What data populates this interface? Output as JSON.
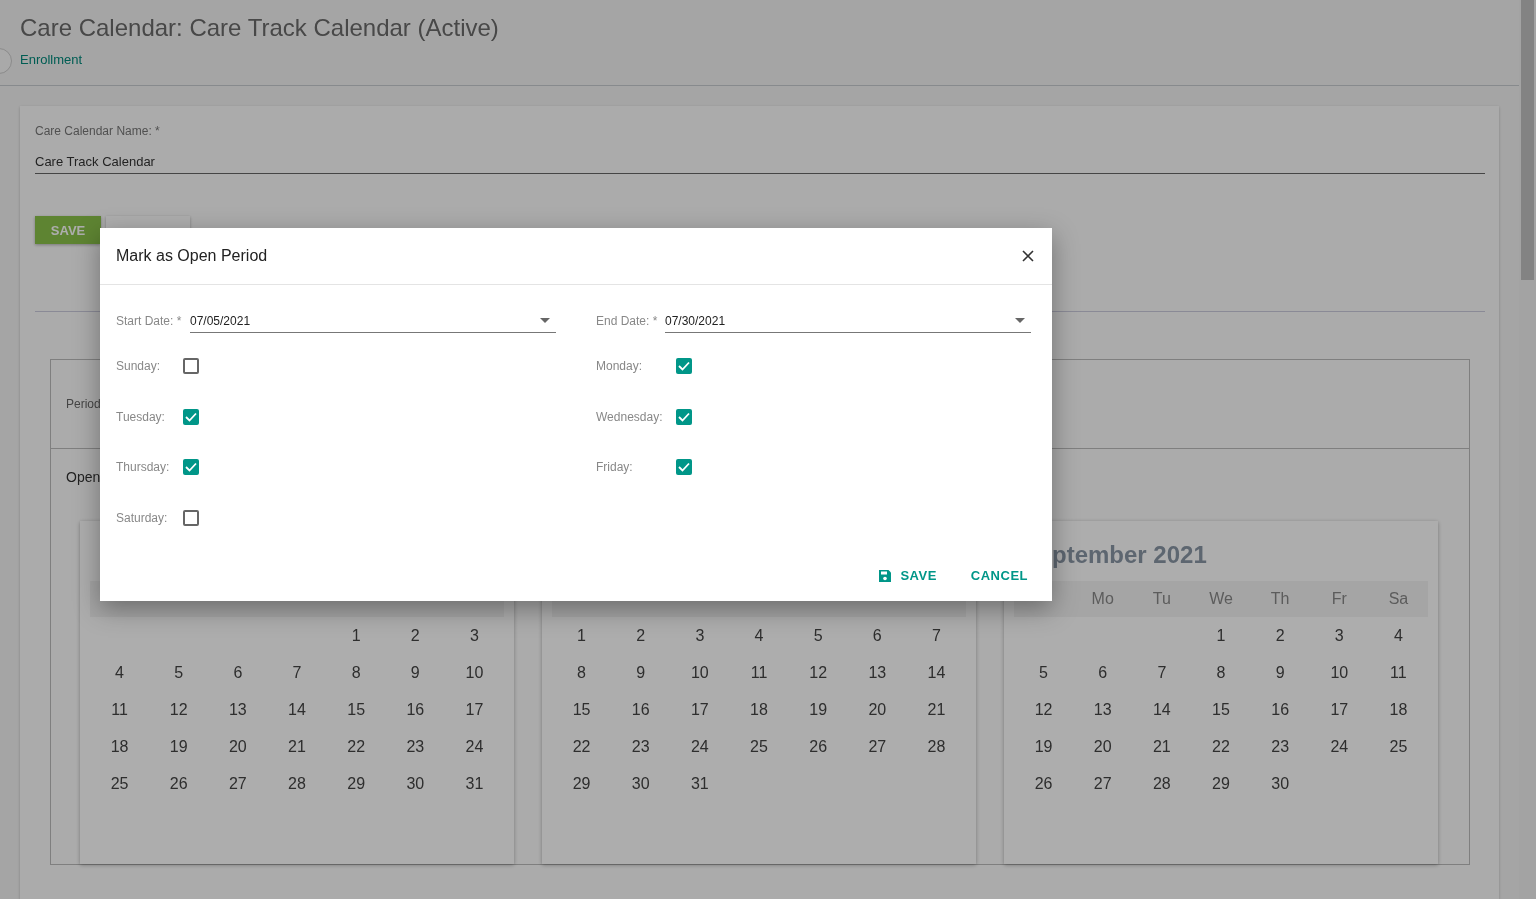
{
  "header": {
    "title": "Care Calendar: Care Track Calendar (Active)",
    "breadcrumb": "Enrollment"
  },
  "form": {
    "name_label": "Care Calendar Name: *",
    "name_value": "Care Track Calendar",
    "save_button": "SAVE"
  },
  "period_panel": {
    "period_label": "Period",
    "open_label": "Open"
  },
  "calendars": [
    {
      "weeks": [
        {
          "kind": "leading",
          "days": [
            "1",
            "2",
            "3"
          ]
        },
        {
          "kind": "full",
          "days": [
            "4",
            "5",
            "6",
            "7",
            "8",
            "9",
            "10"
          ]
        },
        {
          "kind": "full",
          "days": [
            "11",
            "12",
            "13",
            "14",
            "15",
            "16",
            "17"
          ]
        },
        {
          "kind": "full",
          "days": [
            "18",
            "19",
            "20",
            "21",
            "22",
            "23",
            "24"
          ]
        },
        {
          "kind": "full",
          "days": [
            "25",
            "26",
            "27",
            "28",
            "29",
            "30",
            "31"
          ]
        }
      ]
    },
    {
      "weeks": [
        {
          "kind": "full",
          "days": [
            "1",
            "2",
            "3",
            "4",
            "5",
            "6",
            "7"
          ]
        },
        {
          "kind": "full",
          "days": [
            "8",
            "9",
            "10",
            "11",
            "12",
            "13",
            "14"
          ]
        },
        {
          "kind": "full",
          "days": [
            "15",
            "16",
            "17",
            "18",
            "19",
            "20",
            "21"
          ]
        },
        {
          "kind": "full",
          "days": [
            "22",
            "23",
            "24",
            "25",
            "26",
            "27",
            "28"
          ]
        },
        {
          "kind": "trailing",
          "days": [
            "29",
            "30",
            "31"
          ]
        }
      ]
    },
    {
      "title": "ptember 2021",
      "weekdays": [
        "Mo",
        "Tu",
        "We",
        "Th",
        "Fr",
        "Sa"
      ],
      "weeks": [
        {
          "kind": "leading",
          "days": [
            "1",
            "2",
            "3",
            "4"
          ]
        },
        {
          "kind": "full",
          "days": [
            "5",
            "6",
            "7",
            "8",
            "9",
            "10",
            "11"
          ]
        },
        {
          "kind": "full",
          "days": [
            "12",
            "13",
            "14",
            "15",
            "16",
            "17",
            "18"
          ]
        },
        {
          "kind": "full",
          "days": [
            "19",
            "20",
            "21",
            "22",
            "23",
            "24",
            "25"
          ]
        },
        {
          "kind": "trailing",
          "days": [
            "26",
            "27",
            "28",
            "29",
            "30"
          ]
        }
      ]
    }
  ],
  "dialog": {
    "title": "Mark as Open Period",
    "dates": [
      {
        "label": "Start Date: *",
        "value": "07/05/2021"
      },
      {
        "label": "End Date: *",
        "value": "07/30/2021"
      }
    ],
    "days": [
      {
        "label": "Sunday:",
        "checked": false
      },
      {
        "label": "Monday:",
        "checked": true
      },
      {
        "label": "Tuesday:",
        "checked": true
      },
      {
        "label": "Wednesday:",
        "checked": true
      },
      {
        "label": "Thursday:",
        "checked": true
      },
      {
        "label": "Friday:",
        "checked": true
      },
      {
        "label": "Saturday:",
        "checked": false
      }
    ],
    "save_button": "SAVE",
    "cancel_button": "CANCEL"
  }
}
